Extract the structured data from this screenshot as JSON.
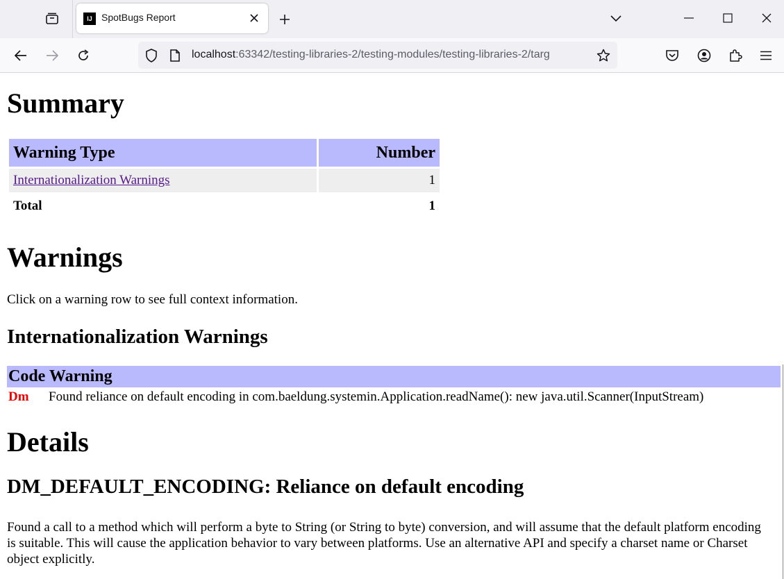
{
  "browser": {
    "tab": {
      "title": "SpotBugs Report",
      "favicon": "IJ"
    },
    "url": {
      "host": "localhost",
      "rest": ":63342/testing-libraries-2/testing-modules/testing-libraries-2/targ"
    },
    "icons": {
      "tab_list": "tab-list-icon",
      "close_tab": "close-icon",
      "new_tab": "plus-icon",
      "overflow": "chevron-down-icon",
      "back": "back-arrow-icon",
      "forward": "forward-arrow-icon",
      "reload": "reload-icon",
      "shield": "shield-icon",
      "page": "page-icon",
      "bookmark": "star-icon",
      "pocket": "pocket-icon",
      "account": "account-icon",
      "extensions": "puzzle-icon",
      "menu": "hamburger-icon"
    }
  },
  "report": {
    "summary_heading": "Summary",
    "summary_table": {
      "headers": [
        "Warning Type",
        "Number"
      ],
      "rows": [
        {
          "type": "Internationalization Warnings",
          "number": "1"
        }
      ],
      "total_label": "Total",
      "total_value": "1"
    },
    "warnings_heading": "Warnings",
    "warnings_intro": "Click on a warning row to see full context information.",
    "category_heading": "Internationalization Warnings",
    "warning_table": {
      "headers": [
        "Code",
        "Warning"
      ],
      "rows": [
        {
          "code": "Dm",
          "warning": "Found reliance on default encoding in com.baeldung.systemin.Application.readName(): new java.util.Scanner(InputStream)"
        }
      ]
    },
    "details_heading": "Details",
    "detail_title": "DM_DEFAULT_ENCODING: Reliance on default encoding",
    "detail_text": "Found a call to a method which will perform a byte to String (or String to byte) conversion, and will assume that the default platform encoding is suitable. This will cause the application behavior to vary between platforms. Use an alternative API and specify a charset name or Charset object explicitly."
  },
  "colors": {
    "header_bg": "#b9b9fe",
    "row_bg": "#eeeeee",
    "code_red": "#ee0000",
    "link": "#551a8b"
  }
}
